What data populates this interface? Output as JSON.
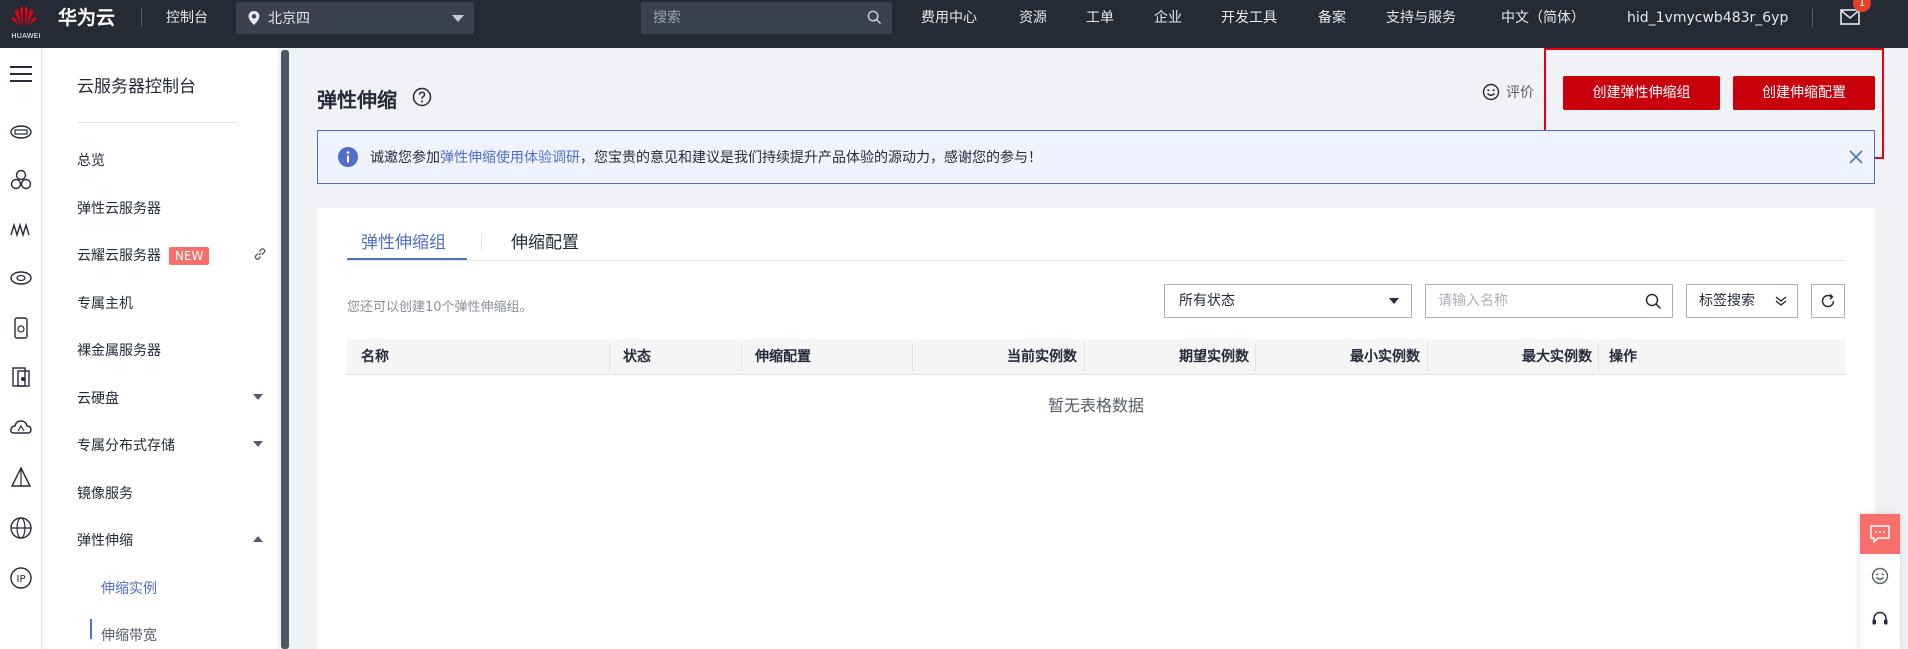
{
  "topbar": {
    "logo_text": "HUAWEI",
    "brand": "华为云",
    "console": "控制台",
    "region": "北京四",
    "search_placeholder": "搜索",
    "nav": [
      "费用中心",
      "资源",
      "工单",
      "企业",
      "开发工具",
      "备案",
      "支持与服务",
      "中文（简体）",
      "hid_1vmycwb483r_6yp"
    ],
    "mail_badge": "1",
    "icon_names": [
      "map-pin-icon",
      "search-icon",
      "mail-icon"
    ]
  },
  "rail": {
    "icons": [
      "menu-icon",
      "cloud-server-icon",
      "container-icon",
      "elastic-scaling-icon",
      "disk-icon",
      "storage-icon",
      "image-icon",
      "cdn-icon",
      "load-balance-icon",
      "network-icon",
      "eip-icon"
    ]
  },
  "sidenav": {
    "title": "云服务器控制台",
    "items": [
      "总览",
      "弹性云服务器",
      "云耀云服务器",
      "专属主机",
      "裸金属服务器",
      "云硬盘",
      "专属分布式存储",
      "镜像服务",
      "弹性伸缩"
    ],
    "new_badge": "NEW",
    "sub_items": [
      "伸缩实例",
      "伸缩带宽"
    ]
  },
  "header": {
    "title": "弹性伸缩",
    "rate_label": "评价",
    "create_group": "创建弹性伸缩组",
    "create_config": "创建伸缩配置"
  },
  "banner": {
    "prefix": "诚邀您参加",
    "link": "弹性伸缩使用体验调研",
    "suffix": "，您宝贵的意见和建议是我们持续提升产品体验的源动力，感谢您的参与！"
  },
  "tabs": [
    "弹性伸缩组",
    "伸缩配置"
  ],
  "toolbar": {
    "quota_text": "您还可以创建10个弹性伸缩组。",
    "status_select": "所有状态",
    "name_placeholder": "请输入名称",
    "tag_search": "标签搜索"
  },
  "table": {
    "columns": [
      "名称",
      "状态",
      "伸缩配置",
      "当前实例数",
      "期望实例数",
      "最小实例数",
      "最大实例数",
      "操作"
    ],
    "empty_text": "暂无表格数据"
  },
  "colors": {
    "topbar": "#252a35",
    "primary_red": "#c7000b",
    "accent_blue": "#526ecc",
    "highlight": "#e60012"
  }
}
